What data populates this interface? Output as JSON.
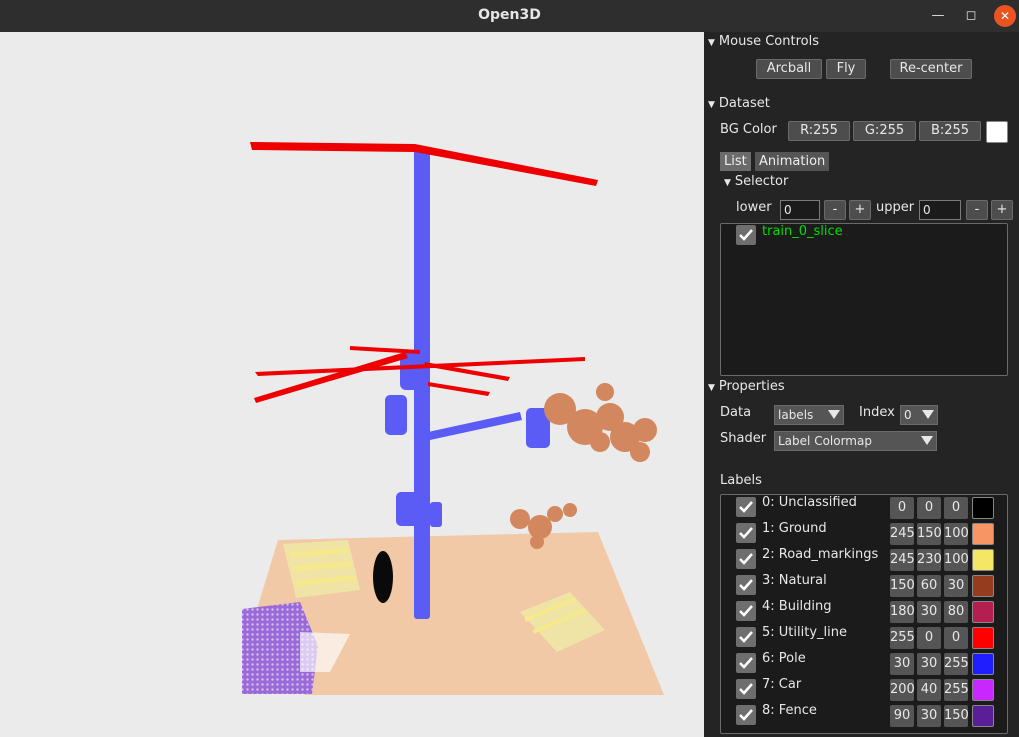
{
  "window": {
    "title": "Open3D"
  },
  "mouse_controls": {
    "header": "Mouse Controls",
    "arcball": "Arcball",
    "fly": "Fly",
    "recenter": "Re-center"
  },
  "dataset": {
    "header": "Dataset",
    "bg_color_label": "BG Color",
    "r": "R:255",
    "g": "G:255",
    "b": "B:255",
    "bg_swatch": "#ffffff",
    "tabs": [
      "List",
      "Animation"
    ],
    "selector": {
      "header": "Selector",
      "lower_label": "lower",
      "lower_value": "0",
      "upper_label": "upper",
      "upper_value": "0",
      "minus": "-",
      "plus": "+"
    },
    "items": [
      {
        "name": "train_0_slice",
        "checked": true,
        "color": "#00e000"
      }
    ]
  },
  "properties": {
    "header": "Properties",
    "data_label": "Data",
    "data_value": "labels",
    "index_label": "Index",
    "index_value": "0",
    "shader_label": "Shader",
    "shader_value": "Label Colormap"
  },
  "labels": {
    "header": "Labels",
    "items": [
      {
        "name": "0: Unclassified",
        "r": "0",
        "g": "0",
        "b": "0",
        "color": "#000000"
      },
      {
        "name": "1: Ground",
        "r": "245",
        "g": "150",
        "b": "100",
        "color": "#f59664"
      },
      {
        "name": "2: Road_markings",
        "r": "245",
        "g": "230",
        "b": "100",
        "color": "#f5e664"
      },
      {
        "name": "3: Natural",
        "r": "150",
        "g": "60",
        "b": "30",
        "color": "#963c1e"
      },
      {
        "name": "4: Building",
        "r": "180",
        "g": "30",
        "b": "80",
        "color": "#b41e50"
      },
      {
        "name": "5: Utility_line",
        "r": "255",
        "g": "0",
        "b": "0",
        "color": "#ff0000"
      },
      {
        "name": "6: Pole",
        "r": "30",
        "g": "30",
        "b": "255",
        "color": "#1e1eff"
      },
      {
        "name": "7: Car",
        "r": "200",
        "g": "40",
        "b": "255",
        "color": "#c828ff"
      },
      {
        "name": "8: Fence",
        "r": "90",
        "g": "30",
        "b": "150",
        "color": "#5a1e96"
      }
    ]
  }
}
